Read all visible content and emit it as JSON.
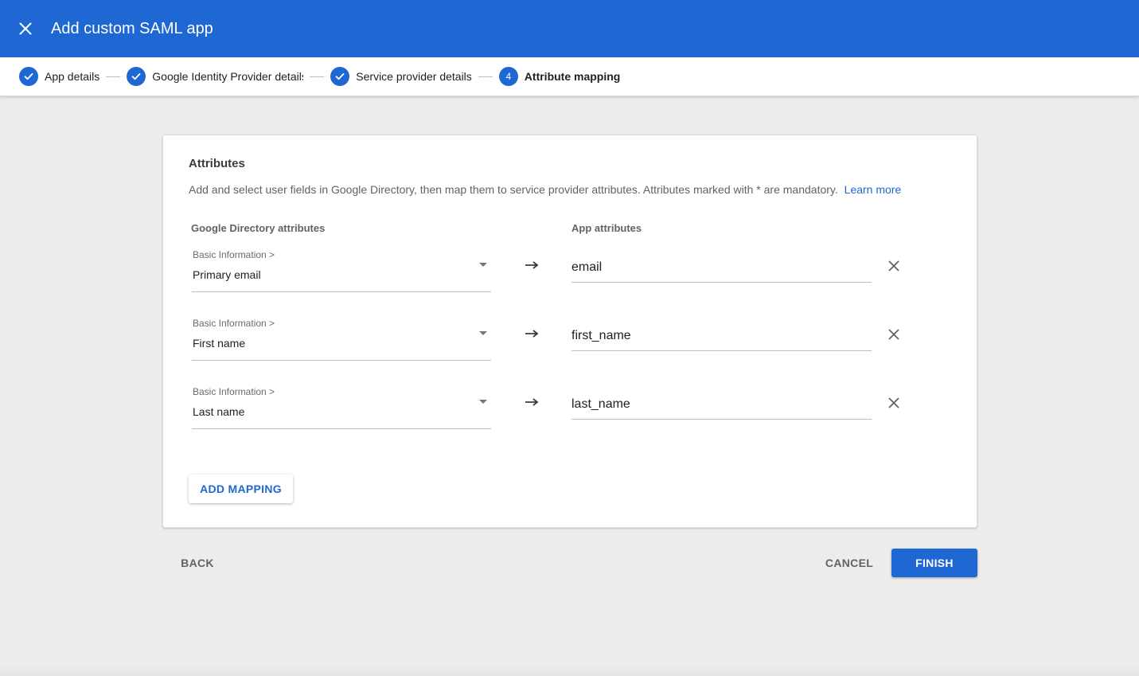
{
  "header": {
    "title": "Add custom SAML app",
    "close_icon": "close-icon",
    "background_color": "#1f67d2"
  },
  "stepper": {
    "steps": [
      {
        "label": "App details",
        "state": "complete",
        "icon": "check-icon"
      },
      {
        "label": "Google Identity Provider details",
        "state": "complete",
        "icon": "check-icon"
      },
      {
        "label": "Service provider details",
        "state": "complete",
        "icon": "check-icon"
      },
      {
        "label": "Attribute mapping",
        "state": "current",
        "number": "4"
      }
    ]
  },
  "card": {
    "title": "Attributes",
    "description": "Add and select user fields in Google Directory, then map them to service provider attributes. Attributes marked with * are mandatory.",
    "learn_more": "Learn more",
    "left_header": "Google Directory attributes",
    "right_header": "App attributes",
    "mappings": [
      {
        "category": "Basic Information >",
        "directory_attribute": "Primary email",
        "app_attribute": "email"
      },
      {
        "category": "Basic Information >",
        "directory_attribute": "First name",
        "app_attribute": "first_name"
      },
      {
        "category": "Basic Information >",
        "directory_attribute": "Last name",
        "app_attribute": "last_name"
      }
    ],
    "add_mapping_label": "ADD MAPPING"
  },
  "footer": {
    "back_label": "BACK",
    "cancel_label": "CANCEL",
    "finish_label": "FINISH"
  }
}
